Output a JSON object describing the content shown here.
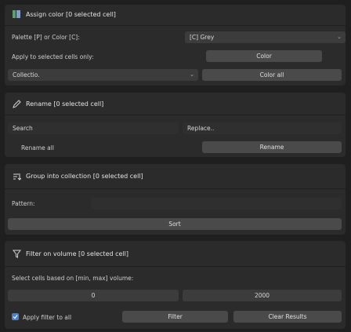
{
  "assign": {
    "title": "Assign color [0 selected cell]",
    "palette_label": "Palette [P] or Color [C]:",
    "palette_value": "[C] Grey",
    "apply_label": "Apply to selected cells only:",
    "color_button": "Color",
    "collection_value": "Collectio.",
    "color_all_button": "Color all",
    "accent": "#4a9a6a"
  },
  "rename": {
    "title": "Rename [0 selected cell]",
    "search_placeholder": "Search",
    "replace_placeholder": "Replace..",
    "rename_all_label": "Rename all",
    "rename_button": "Rename"
  },
  "group": {
    "title": "Group into collection [0 selected cell]",
    "pattern_label": "Pattern:",
    "sort_button": "Sort"
  },
  "filter": {
    "title": "Filter on volume [0 selected cell]",
    "description": "Select cells based on [min, max] volume:",
    "min_value": "0",
    "max_value": "2000",
    "apply_all_label": "Apply filter to all",
    "filter_button": "Filter",
    "clear_button": "Clear Results",
    "checkbox_color": "#4a7fd0"
  }
}
